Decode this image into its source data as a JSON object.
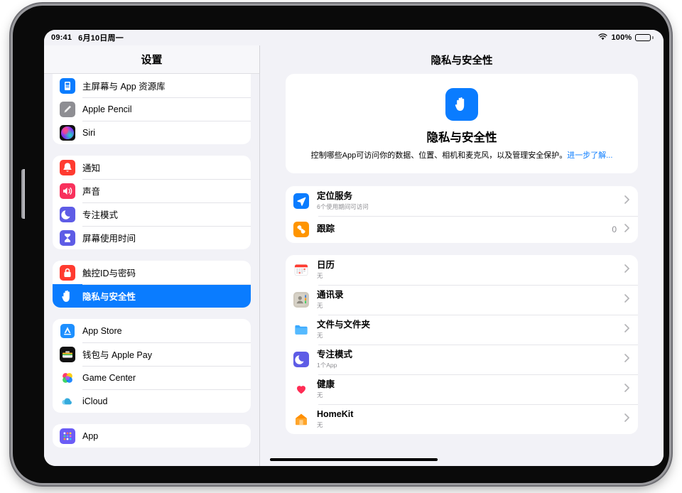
{
  "status_bar": {
    "time": "09:41",
    "date": "6月10日周一",
    "wifi_icon": "wifi-icon",
    "battery_percent": "100%",
    "battery_icon": "battery-full-icon"
  },
  "sidebar": {
    "title": "设置",
    "groups": [
      {
        "items": [
          {
            "label": "主屏幕与 App 资源库",
            "icon": "home-screen-icon",
            "selected": false
          },
          {
            "label": "Apple Pencil",
            "icon": "apple-pencil-icon",
            "selected": false
          },
          {
            "label": "Siri",
            "icon": "siri-icon",
            "selected": false
          }
        ]
      },
      {
        "items": [
          {
            "label": "通知",
            "icon": "notifications-bell-icon",
            "selected": false
          },
          {
            "label": "声音",
            "icon": "sound-speaker-icon",
            "selected": false
          },
          {
            "label": "专注模式",
            "icon": "focus-moon-icon",
            "selected": false
          },
          {
            "label": "屏幕使用时间",
            "icon": "screen-time-hourglass-icon",
            "selected": false
          }
        ]
      },
      {
        "items": [
          {
            "label": "触控ID与密码",
            "icon": "touch-id-lock-icon",
            "selected": false
          },
          {
            "label": "隐私与安全性",
            "icon": "privacy-hand-icon",
            "selected": true
          }
        ]
      },
      {
        "items": [
          {
            "label": "App Store",
            "icon": "app-store-icon",
            "selected": false
          },
          {
            "label": "钱包与 Apple Pay",
            "icon": "wallet-icon",
            "selected": false
          },
          {
            "label": "Game Center",
            "icon": "game-center-icon",
            "selected": false
          },
          {
            "label": "iCloud",
            "icon": "icloud-icon",
            "selected": false
          }
        ]
      },
      {
        "items": [
          {
            "label": "App",
            "icon": "app-grid-icon",
            "selected": false
          }
        ]
      }
    ]
  },
  "content": {
    "title": "隐私与安全性",
    "hero": {
      "icon": "privacy-hand-icon",
      "title": "隐私与安全性",
      "description": "控制哪些App可访问你的数据、位置、相机和麦克风，以及管理安全保护。",
      "link_label": "进一步了解...",
      "accent_color": "#0a7cff"
    },
    "groups": [
      {
        "rows": [
          {
            "title": "定位服务",
            "subtitle": "6个使用期间可访问",
            "value": "",
            "icon": "location-arrow-icon",
            "chevron": "chevron-right-icon"
          },
          {
            "title": "跟踪",
            "subtitle": "",
            "value": "0",
            "icon": "tracking-icon",
            "chevron": "chevron-right-icon"
          }
        ]
      },
      {
        "rows": [
          {
            "title": "日历",
            "subtitle": "无",
            "value": "",
            "icon": "calendar-icon",
            "chevron": "chevron-right-icon"
          },
          {
            "title": "通讯录",
            "subtitle": "无",
            "value": "",
            "icon": "contacts-icon",
            "chevron": "chevron-right-icon"
          },
          {
            "title": "文件与文件夹",
            "subtitle": "无",
            "value": "",
            "icon": "files-folder-icon",
            "chevron": "chevron-right-icon"
          },
          {
            "title": "专注模式",
            "subtitle": "1个App",
            "value": "",
            "icon": "focus-moon-icon",
            "chevron": "chevron-right-icon"
          },
          {
            "title": "健康",
            "subtitle": "无",
            "value": "",
            "icon": "health-heart-icon",
            "chevron": "chevron-right-icon"
          },
          {
            "title": "HomeKit",
            "subtitle": "无",
            "value": "",
            "icon": "homekit-house-icon",
            "chevron": "chevron-right-icon"
          }
        ]
      }
    ]
  }
}
